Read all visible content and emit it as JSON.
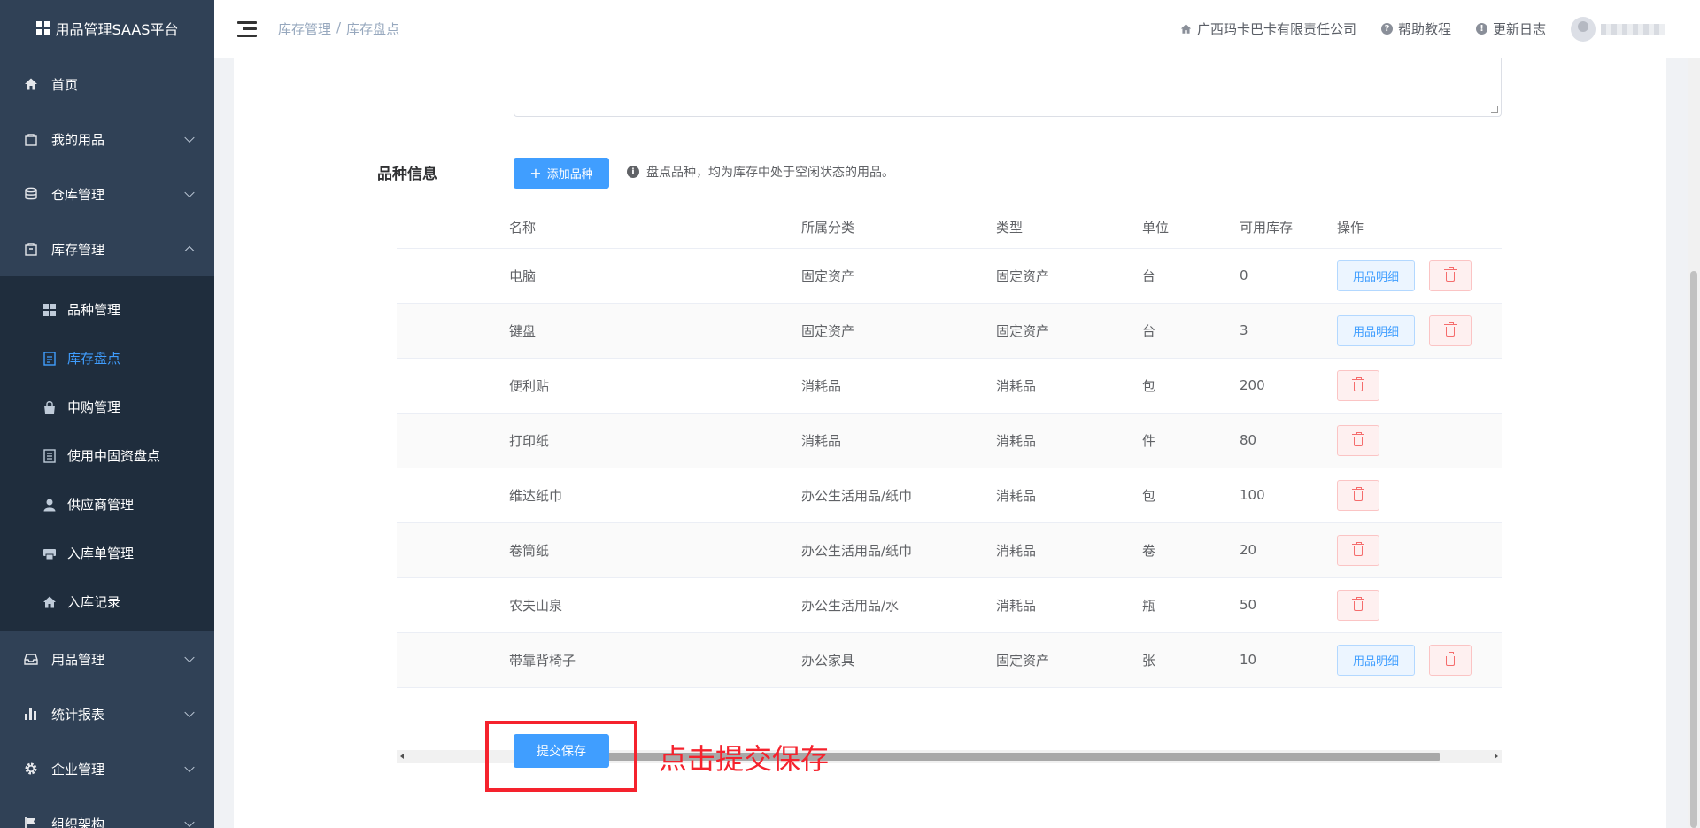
{
  "sidebar": {
    "logo_text": "用品管理SAAS平台",
    "items": [
      {
        "label": "首页",
        "icon": "home-icon"
      },
      {
        "label": "我的用品",
        "icon": "bag-icon"
      },
      {
        "label": "仓库管理",
        "icon": "database-icon"
      },
      {
        "label": "库存管理",
        "icon": "box-icon"
      },
      {
        "label": "用品管理",
        "icon": "inbox-icon"
      },
      {
        "label": "统计报表",
        "icon": "bar-chart-icon"
      },
      {
        "label": "企业管理",
        "icon": "gear-icon"
      },
      {
        "label": "组织架构",
        "icon": "flag-icon"
      }
    ],
    "sub_items": [
      {
        "label": "品种管理",
        "icon": "grid-icon"
      },
      {
        "label": "库存盘点",
        "icon": "document-icon",
        "active": true
      },
      {
        "label": "申购管理",
        "icon": "shopping-bag-icon"
      },
      {
        "label": "使用中固资盘点",
        "icon": "file-icon"
      },
      {
        "label": "供应商管理",
        "icon": "user-icon"
      },
      {
        "label": "入库单管理",
        "icon": "printer-icon"
      },
      {
        "label": "入库记录",
        "icon": "home-icon"
      }
    ]
  },
  "header": {
    "breadcrumb": [
      "库存管理",
      "库存盘点"
    ],
    "company": "广西玛卡巴卡有限责任公司",
    "help": "帮助教程",
    "changelog": "更新日志"
  },
  "form": {
    "section_label": "品种信息",
    "add_button": "添加品种",
    "hint": "盘点品种，均为库存中处于空闲状态的用品。",
    "submit_button": "提交保存"
  },
  "table": {
    "columns": [
      "名称",
      "所属分类",
      "类型",
      "单位",
      "可用库存",
      "操作"
    ],
    "rows": [
      {
        "name": "电脑",
        "category": "固定资产",
        "type": "固定资产",
        "unit": "台",
        "stock": "0",
        "detail": true
      },
      {
        "name": "键盘",
        "category": "固定资产",
        "type": "固定资产",
        "unit": "台",
        "stock": "3",
        "detail": true
      },
      {
        "name": "便利贴",
        "category": "消耗品",
        "type": "消耗品",
        "unit": "包",
        "stock": "200",
        "detail": false
      },
      {
        "name": "打印纸",
        "category": "消耗品",
        "type": "消耗品",
        "unit": "件",
        "stock": "80",
        "detail": false
      },
      {
        "name": "维达纸巾",
        "category": "办公生活用品/纸巾",
        "type": "消耗品",
        "unit": "包",
        "stock": "100",
        "detail": false
      },
      {
        "name": "卷筒纸",
        "category": "办公生活用品/纸巾",
        "type": "消耗品",
        "unit": "卷",
        "stock": "20",
        "detail": false
      },
      {
        "name": "农夫山泉",
        "category": "办公生活用品/水",
        "type": "消耗品",
        "unit": "瓶",
        "stock": "50",
        "detail": false
      },
      {
        "name": "带靠背椅子",
        "category": "办公家具",
        "type": "固定资产",
        "unit": "张",
        "stock": "10",
        "detail": true
      }
    ],
    "detail_label": "用品明细"
  },
  "annotation": "点击提交保存",
  "colors": {
    "primary": "#409eff",
    "sidebar": "#304156",
    "danger": "#f56c6c",
    "annotation": "#f5222d"
  }
}
